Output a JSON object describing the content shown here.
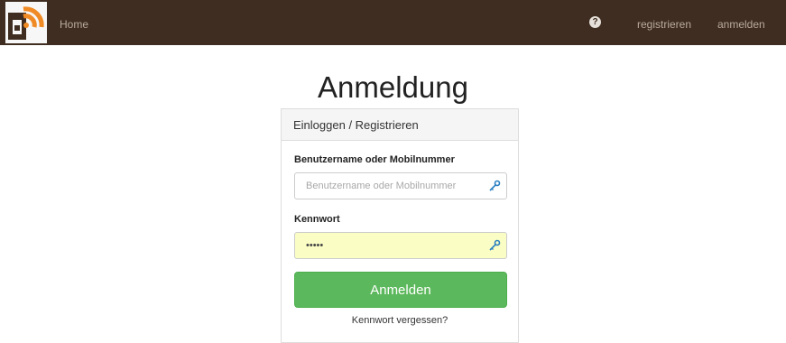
{
  "navbar": {
    "home_label": "Home",
    "help_icon": "question-circle-icon",
    "register_label": "registrieren",
    "login_label": "anmelden",
    "bg_color": "#3e2d20"
  },
  "page": {
    "title": "Anmeldung"
  },
  "panel": {
    "heading": "Einloggen / Registrieren",
    "username": {
      "label": "Benutzername oder Mobilnummer",
      "placeholder": "Benutzername oder Mobilnummer",
      "value": ""
    },
    "password": {
      "label": "Kennwort",
      "value": "•••••"
    },
    "submit_label": "Anmelden",
    "forgot_label": "Kennwort vergessen?",
    "accent_color": "#5cb85c"
  }
}
